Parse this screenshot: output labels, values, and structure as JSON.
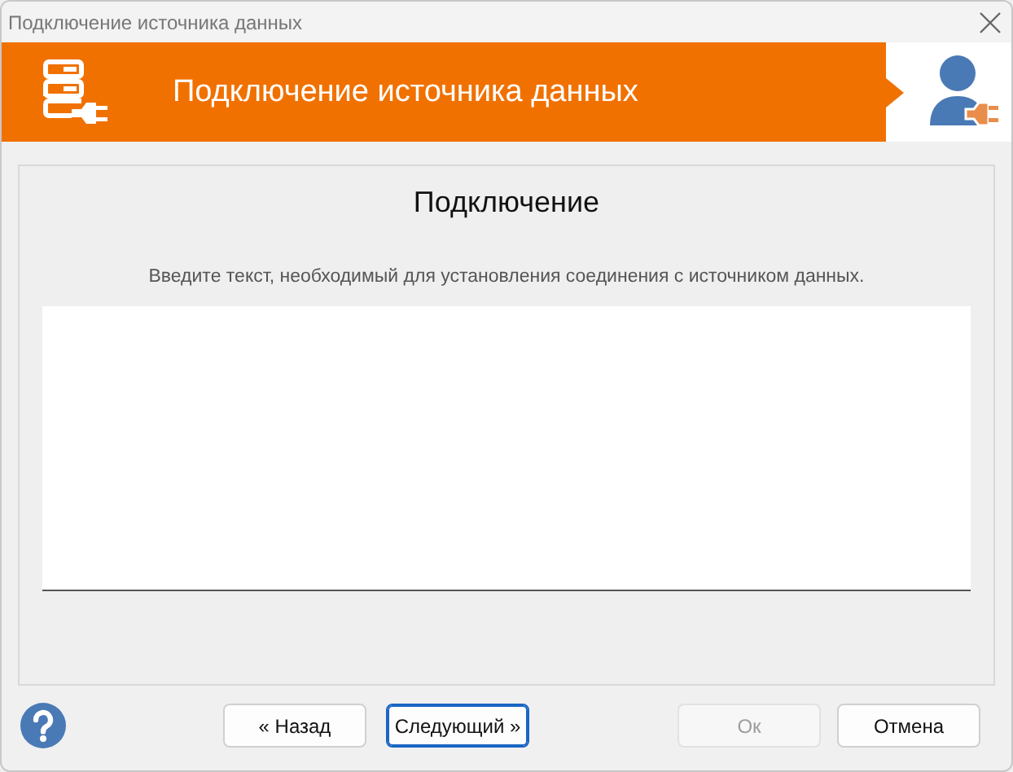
{
  "window": {
    "title": "Подключение источника данных"
  },
  "banner": {
    "title": "Подключение источника данных"
  },
  "page": {
    "heading": "Подключение",
    "instruction": "Введите текст, необходимый для установления соединения с источником данных."
  },
  "nav_buttons": [
    {
      "label": "« Назад",
      "disabled": false,
      "default": false
    },
    {
      "label": "Следующий »",
      "disabled": false,
      "default": true
    }
  ],
  "dialog_buttons": [
    {
      "label": "Ок",
      "disabled": true,
      "default": false
    },
    {
      "label": "Отмена",
      "disabled": false,
      "default": false
    }
  ]
}
